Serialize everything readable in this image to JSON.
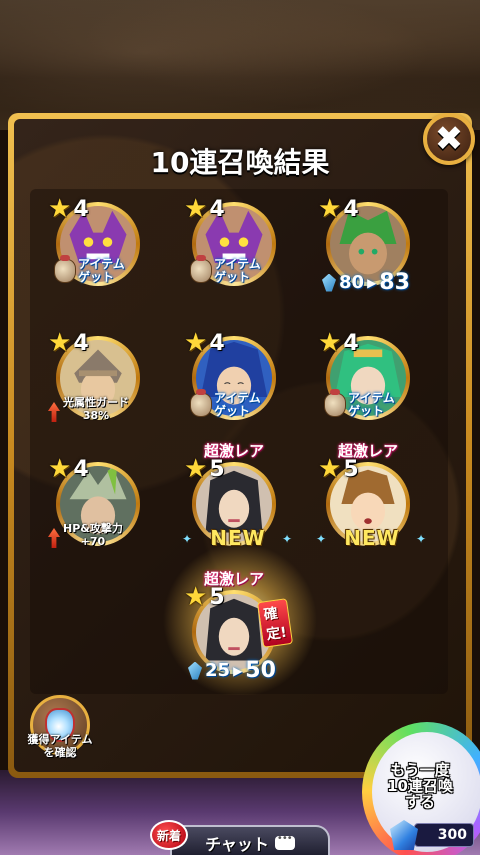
{
  "dialog": {
    "title": "10連召喚結果",
    "close_icon": "✖"
  },
  "results": [
    {
      "rarity": "4",
      "type": "item",
      "item_text": "アイテムゲット"
    },
    {
      "rarity": "4",
      "type": "item",
      "item_text": "アイテムゲット"
    },
    {
      "rarity": "4",
      "type": "levelup",
      "level_from": "80",
      "level_to": "83"
    },
    {
      "rarity": "4",
      "type": "stat",
      "stat_text": "光属性ガード38%"
    },
    {
      "rarity": "4",
      "type": "item",
      "item_text": "アイテムゲット"
    },
    {
      "rarity": "4",
      "type": "item",
      "item_text": "アイテムゲット"
    },
    {
      "rarity": "4",
      "type": "stat",
      "stat_text": "HP&攻撃力+70"
    },
    {
      "rarity": "5",
      "type": "new",
      "rare_label": "超激レア",
      "new_text": "NEW"
    },
    {
      "rarity": "5",
      "type": "new",
      "rare_label": "超激レア",
      "new_text": "NEW"
    },
    {
      "rarity": "5",
      "type": "levelup",
      "rare_label": "超激レア",
      "level_from": "25",
      "level_to": "50",
      "confirm_text": "確定!"
    }
  ],
  "labels": {
    "item_line1": "アイテム",
    "item_line2": "ゲット",
    "stat1_line1": "光属性ガード",
    "stat1_line2": "38%",
    "stat2_line1": "HP&攻撃力",
    "stat2_line2": "+70"
  },
  "obtained_items": {
    "line1": "獲得アイテム",
    "line2": "を確認"
  },
  "summon_again": {
    "line1": "もう一度",
    "line2": "10連召喚",
    "line3": "する",
    "cost": "300"
  },
  "chat": {
    "label": "チャット",
    "new_badge": "新着"
  },
  "colors": {
    "frame_gold": "#e8b040",
    "panel_bg": "#2b1d12",
    "rare_pink": "#e02070",
    "new_yellow": "#ffe860"
  }
}
